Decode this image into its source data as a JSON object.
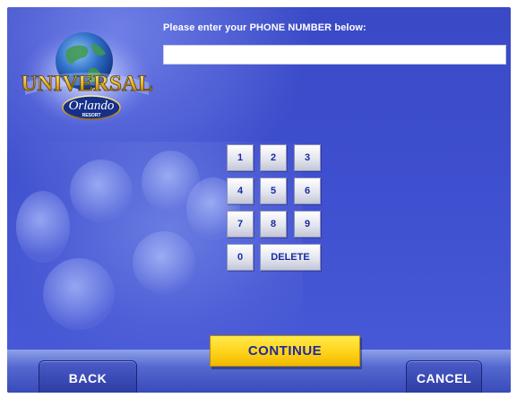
{
  "logo": {
    "brand_text": "UNIVERSAL",
    "script_text": "Orlando",
    "sub_text": "RESORT"
  },
  "prompt": {
    "label": "Please enter your PHONE NUMBER below:"
  },
  "phone_field": {
    "value": ""
  },
  "keypad": {
    "keys": [
      "1",
      "2",
      "3",
      "4",
      "5",
      "6",
      "7",
      "8",
      "9",
      "0"
    ],
    "delete_label": "DELETE"
  },
  "actions": {
    "continue_label": "CONTINUE",
    "back_label": "BACK",
    "cancel_label": "CANCEL"
  },
  "colors": {
    "background": "#3e4fcf",
    "continue_button": "#ffd21a",
    "key_text": "#1b2b9e"
  }
}
